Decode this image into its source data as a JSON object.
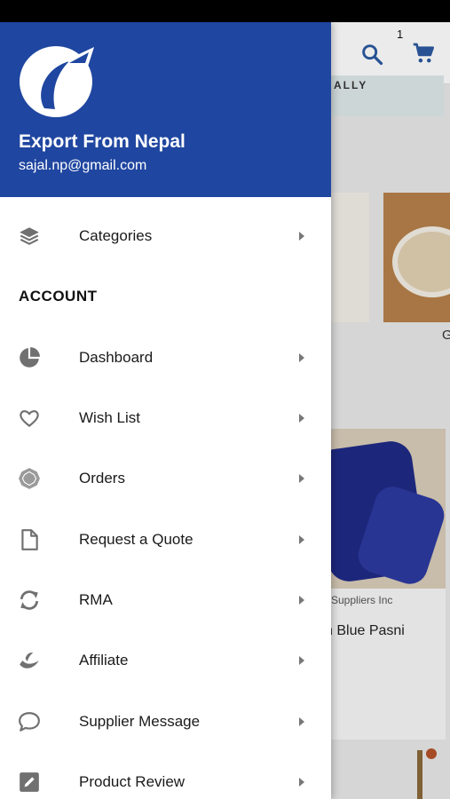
{
  "drawer": {
    "app_title": "Export From Nepal",
    "user_email": "sajal.np@gmail.com",
    "brand_color": "#1f46a0",
    "section_account": "ACCOUNT",
    "items": [
      {
        "label": "Categories",
        "icon": "layers-icon"
      },
      {
        "label": "Dashboard",
        "icon": "pie-chart-icon"
      },
      {
        "label": "Wish List",
        "icon": "heart-icon"
      },
      {
        "label": "Orders",
        "icon": "orders-icon"
      },
      {
        "label": "Request a Quote",
        "icon": "document-icon"
      },
      {
        "label": "RMA",
        "icon": "refresh-icon"
      },
      {
        "label": "Affiliate",
        "icon": "affiliate-icon"
      },
      {
        "label": "Supplier Message",
        "icon": "chat-bubble-icon"
      },
      {
        "label": "Product Review",
        "icon": "edit-icon"
      }
    ]
  },
  "background": {
    "cart_count": "1",
    "banner_text": "ALLY",
    "card_letter": "G",
    "supplier_text": "Suppliers Inc",
    "product_text": "n Blue Pasni"
  }
}
